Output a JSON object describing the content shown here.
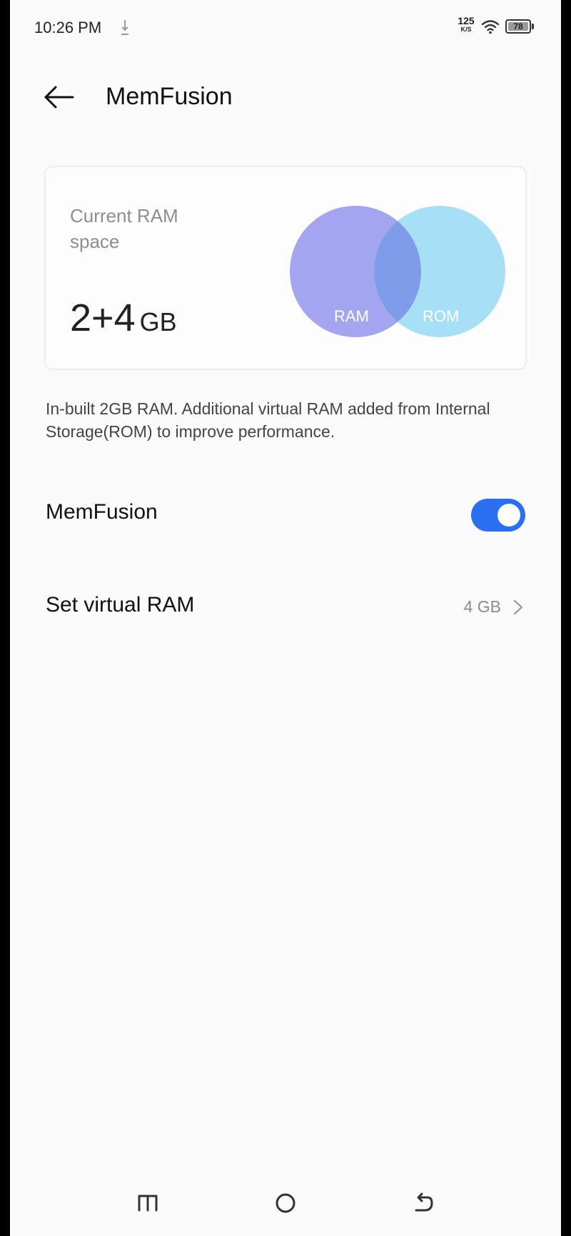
{
  "status_bar": {
    "time": "10:26 PM",
    "net_speed_value": "125",
    "net_speed_unit": "K/S",
    "battery_level": "78",
    "icons": [
      "download-icon",
      "wifi-icon",
      "battery-icon"
    ]
  },
  "header": {
    "title": "MemFusion",
    "back_icon": "arrow-left-icon"
  },
  "ram_card": {
    "label": "Current RAM space",
    "value": "2+4",
    "unit": "GB",
    "venn": {
      "left_label": "RAM",
      "right_label": "ROM",
      "left_color": "#a3a6ee",
      "right_color": "#a6dff6",
      "overlap_color": "#7f9cea"
    }
  },
  "description": "In-built 2GB RAM. Additional virtual RAM added from Internal Storage(ROM) to improve performance.",
  "settings": {
    "memfusion": {
      "label": "MemFusion",
      "enabled": true
    },
    "virtual_ram": {
      "label": "Set virtual RAM",
      "value": "4 GB"
    }
  },
  "colors": {
    "accent": "#2a6ff1",
    "background": "#fbfbfb"
  },
  "nav_bar": {
    "icons": [
      "menu-icon",
      "home-icon",
      "back-icon"
    ]
  }
}
